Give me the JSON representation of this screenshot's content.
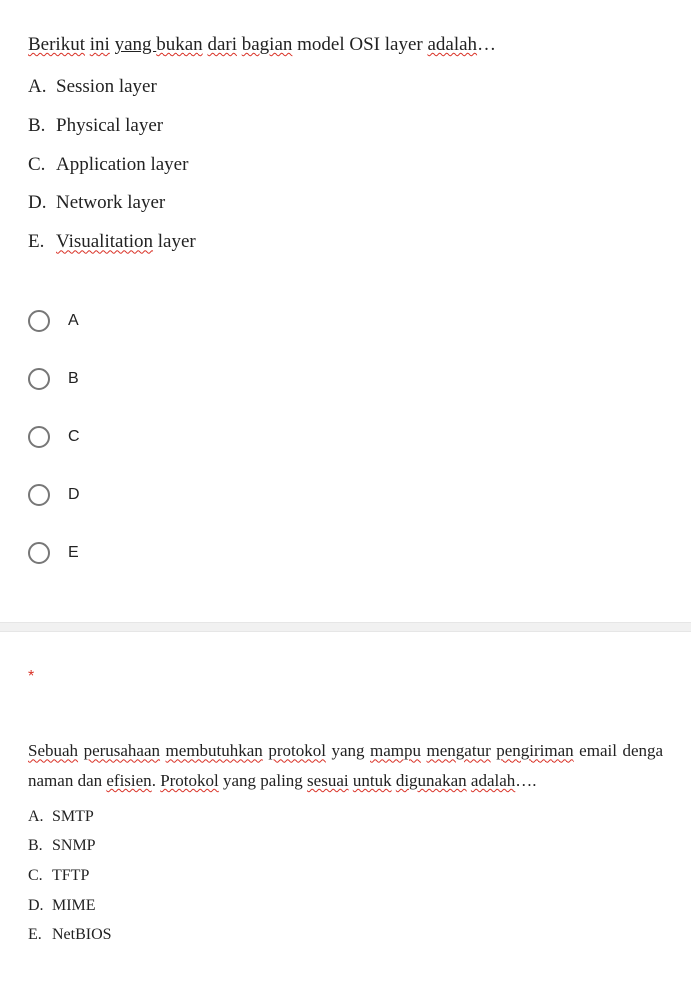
{
  "q1": {
    "prompt_parts": [
      {
        "t": "Berikut",
        "cls": "sp"
      },
      {
        "t": " "
      },
      {
        "t": "ini",
        "cls": "sp"
      },
      {
        "t": " "
      },
      {
        "t": "yang ",
        "cls": "und"
      },
      {
        "t": "bukan",
        "cls": "sp"
      },
      {
        "t": " "
      },
      {
        "t": "dari",
        "cls": "sp"
      },
      {
        "t": " "
      },
      {
        "t": "bagian",
        "cls": "sp"
      },
      {
        "t": " model OSI layer "
      },
      {
        "t": "adalah",
        "cls": "sp"
      },
      {
        "t": "…"
      }
    ],
    "items": [
      {
        "letter": "A.",
        "label": "Session layer",
        "label_cls": ""
      },
      {
        "letter": "B.",
        "label": "Physical layer",
        "label_cls": ""
      },
      {
        "letter": "C.",
        "label": "Application layer",
        "label_cls": ""
      },
      {
        "letter": "D.",
        "label": "Network layer",
        "label_cls": ""
      },
      {
        "letter": "E.",
        "label_parts": [
          {
            "t": "Visualitation",
            "cls": "sp"
          },
          {
            "t": " layer"
          }
        ]
      }
    ],
    "choices": [
      "A",
      "B",
      "C",
      "D",
      "E"
    ]
  },
  "q2": {
    "required_mark": "*",
    "prompt_parts": [
      {
        "t": "Sebuah",
        "cls": "sp"
      },
      {
        "t": " "
      },
      {
        "t": "perusahaan",
        "cls": "sp"
      },
      {
        "t": " "
      },
      {
        "t": "membutuhkan",
        "cls": "sp"
      },
      {
        "t": " "
      },
      {
        "t": "protokol",
        "cls": "sp"
      },
      {
        "t": " yang "
      },
      {
        "t": "mampu",
        "cls": "sp"
      },
      {
        "t": " "
      },
      {
        "t": "mengatur",
        "cls": "sp"
      },
      {
        "t": " "
      },
      {
        "t": "pengiriman",
        "cls": "sp"
      },
      {
        "t": " email denga naman dan "
      },
      {
        "t": "efisien",
        "cls": "sp"
      },
      {
        "t": ". "
      },
      {
        "t": "Protokol",
        "cls": "sp"
      },
      {
        "t": " yang paling "
      },
      {
        "t": "sesuai",
        "cls": "sp"
      },
      {
        "t": " "
      },
      {
        "t": "untuk",
        "cls": "sp"
      },
      {
        "t": " "
      },
      {
        "t": "digunakan",
        "cls": "sp"
      },
      {
        "t": " "
      },
      {
        "t": "adalah",
        "cls": "sp"
      },
      {
        "t": "…."
      }
    ],
    "items": [
      {
        "letter": "A.",
        "label": "SMTP"
      },
      {
        "letter": "B.",
        "label": "SNMP"
      },
      {
        "letter": "C.",
        "label": "TFTP"
      },
      {
        "letter": "D.",
        "label": "MIME"
      },
      {
        "letter": "E.",
        "label": "NetBIOS"
      }
    ]
  }
}
